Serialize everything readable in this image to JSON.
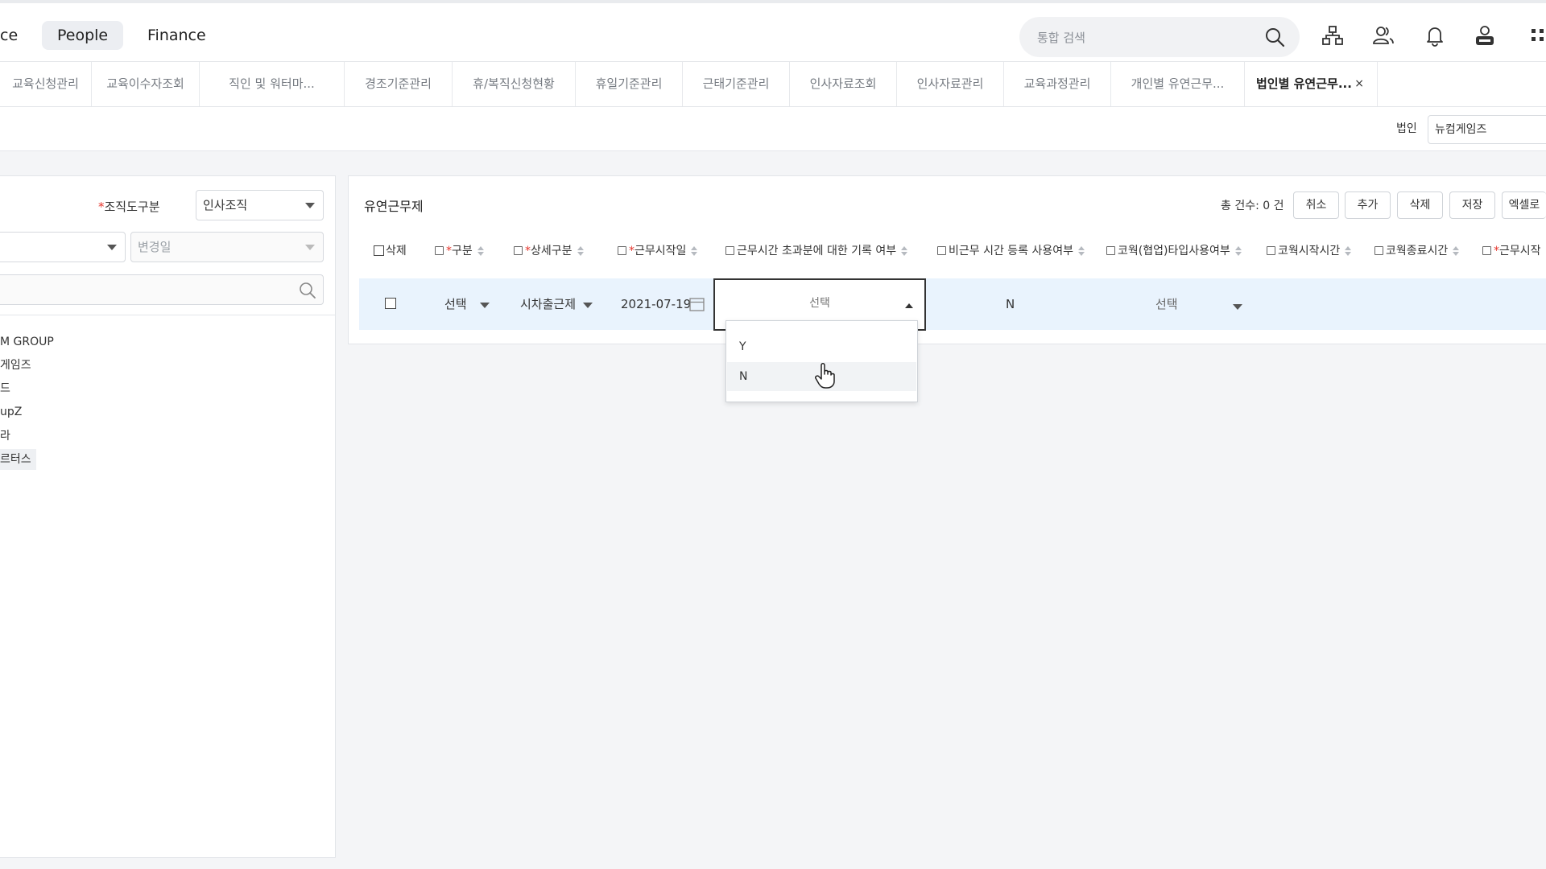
{
  "topnav": [
    "ce",
    "People",
    "Finance"
  ],
  "search": {
    "placeholder": "통합 검색"
  },
  "tabs": [
    "교육신청관리",
    "교육이수자조회",
    "직인 및 워터마...",
    "경조기준관리",
    "휴/복직신청현황",
    "휴일기준관리",
    "근태기준관리",
    "인사자료조회",
    "인사자료관리",
    "교육과정관리",
    "개인별 유연근무..."
  ],
  "active_tab": {
    "label": "법인별 유연근무...",
    "close": "×"
  },
  "filter": {
    "corp_label": "법인",
    "corp_value": "뉴컴게임즈"
  },
  "left": {
    "org_label": "조직도구분",
    "org_value": "인사조직",
    "change_date": "변경일",
    "tree": [
      "M GROUP",
      "게임즈",
      "드",
      "upZ",
      "라",
      "르터스"
    ]
  },
  "panel": {
    "title": "유연근무제",
    "count": "총 건수: 0 건",
    "buttons": [
      "취소",
      "추가",
      "삭제",
      "저장",
      "엑셀로"
    ]
  },
  "columns": {
    "delete": "삭제",
    "type": "구분",
    "detail_type": "상세구분",
    "start_date": "근무시작일",
    "overtime_record": "근무시간 초과분에 대한 기록 여부",
    "nonwork_use": "비근무 시간 등록 사용여부",
    "cowork_type": "코웍(협업)타입사용여부",
    "cowork_start": "코웍시작시간",
    "cowork_end": "코웍종료시간",
    "work_start": "근무시작"
  },
  "row": {
    "type": "선택",
    "detail_type": "시차출근제",
    "start_date": "2021-07-19",
    "overtime_record": "선택",
    "nonwork_use": "N",
    "cowork_type": "선택"
  },
  "dropdown_options": [
    "Y",
    "N"
  ]
}
